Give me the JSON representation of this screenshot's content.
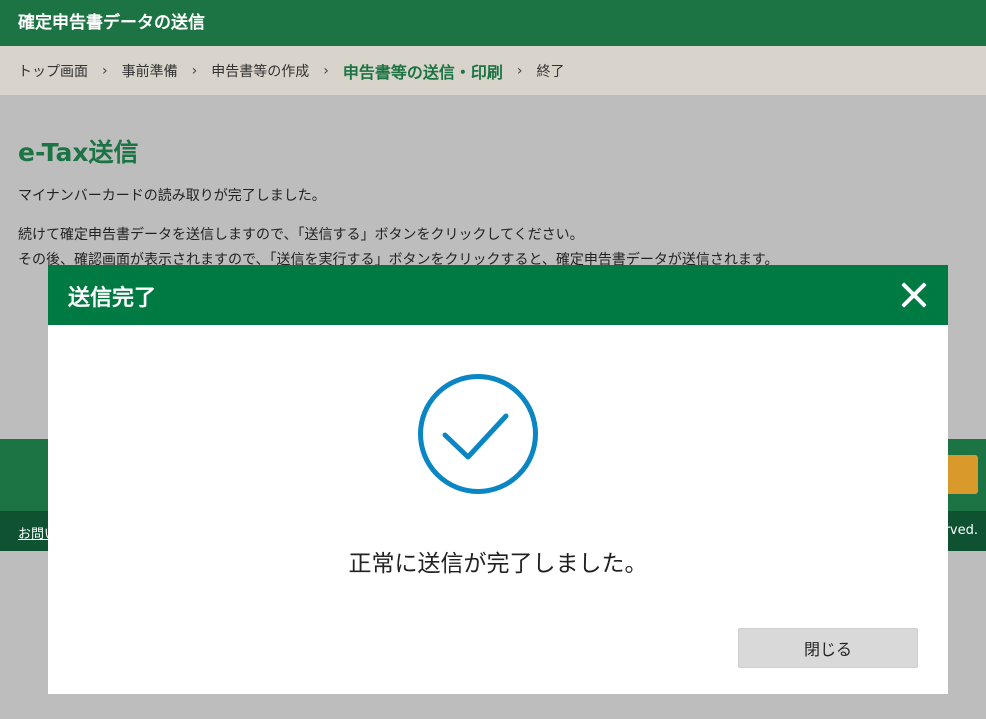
{
  "header": {
    "title": "確定申告書データの送信"
  },
  "breadcrumb": {
    "items": [
      {
        "label": "トップ画面"
      },
      {
        "label": "事前準備"
      },
      {
        "label": "申告書等の作成"
      },
      {
        "label": "申告書等の送信・印刷"
      },
      {
        "label": "終了"
      }
    ],
    "separator": "›"
  },
  "main": {
    "title": "e-Tax送信",
    "paragraph1": "マイナンバーカードの読み取りが完了しました。",
    "paragraph2": "続けて確定申告書データを送信しますので、「送信する」ボタンをクリックしてください。",
    "paragraph3": "その後、確認画面が表示されますので、「送信を実行する」ボタンをクリックすると、確定申告書データが送信されます。"
  },
  "footer": {
    "link_partial": "お問い",
    "copyright_partial": "rved."
  },
  "modal": {
    "title": "送信完了",
    "message": "正常に送信が完了しました。",
    "close_label": "閉じる",
    "icon": "check-circle-icon",
    "close_icon": "close-icon"
  },
  "colors": {
    "header": "#1c7444",
    "modal_header": "#007a43",
    "check": "#0a86c4",
    "breadcrumb_bg": "#d8d3cb",
    "overlay_bg": "#bdbdbd",
    "orange": "#d99a2b"
  }
}
